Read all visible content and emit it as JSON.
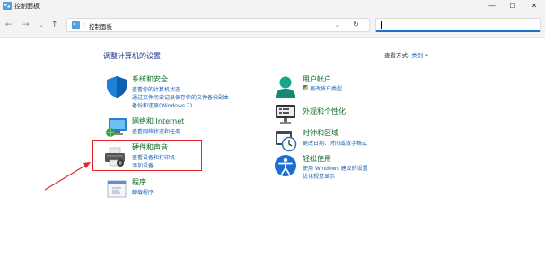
{
  "window": {
    "title": "控制面板",
    "minimize": "—",
    "maximize": "☐",
    "close": "✕"
  },
  "nav": {
    "back": "←",
    "forward": "→",
    "recent": "⌄",
    "up": "↑",
    "address_separator": "›",
    "address_text": "控制面板",
    "address_dropdown": "⌄",
    "refresh": "↻"
  },
  "search": {
    "placeholder": "",
    "value": ""
  },
  "heading": "调整计算机的设置",
  "view_by": {
    "label": "查看方式:",
    "value": "类别 ▾"
  },
  "categories": {
    "system_security": {
      "title": "系统和安全",
      "icon": "shield-icon",
      "links": [
        "查看你的计算机状态",
        "通过文件历史记录保存你的文件备份副本",
        "备份和还原(Windows 7)"
      ]
    },
    "network_internet": {
      "title": "网络和 Internet",
      "icon": "network-icon",
      "links": [
        "查看网络状态和任务"
      ]
    },
    "hardware_sound": {
      "title": "硬件和声音",
      "icon": "printer-icon",
      "links": [
        "查看设备和打印机",
        "添加设备"
      ]
    },
    "programs": {
      "title": "程序",
      "icon": "programs-icon",
      "links": [
        "卸载程序"
      ]
    },
    "user_accounts": {
      "title": "用户帐户",
      "icon": "user-icon",
      "links": [
        "更改帐户类型"
      ]
    },
    "appearance": {
      "title": "外观和个性化",
      "icon": "monitor-icon",
      "links": []
    },
    "clock_region": {
      "title": "时钟和区域",
      "icon": "clock-icon",
      "links": [
        "更改日期、时间或数字格式"
      ]
    },
    "ease_of_access": {
      "title": "轻松使用",
      "icon": "accessibility-icon",
      "links": [
        "使用 Windows 建议的设置",
        "优化视觉显示"
      ]
    }
  },
  "colors": {
    "accent": "#1e6fcf",
    "heading": "#1e3287",
    "category_title": "#0b6a23",
    "link": "#1a5fb4",
    "annotation": "#e0262a"
  }
}
